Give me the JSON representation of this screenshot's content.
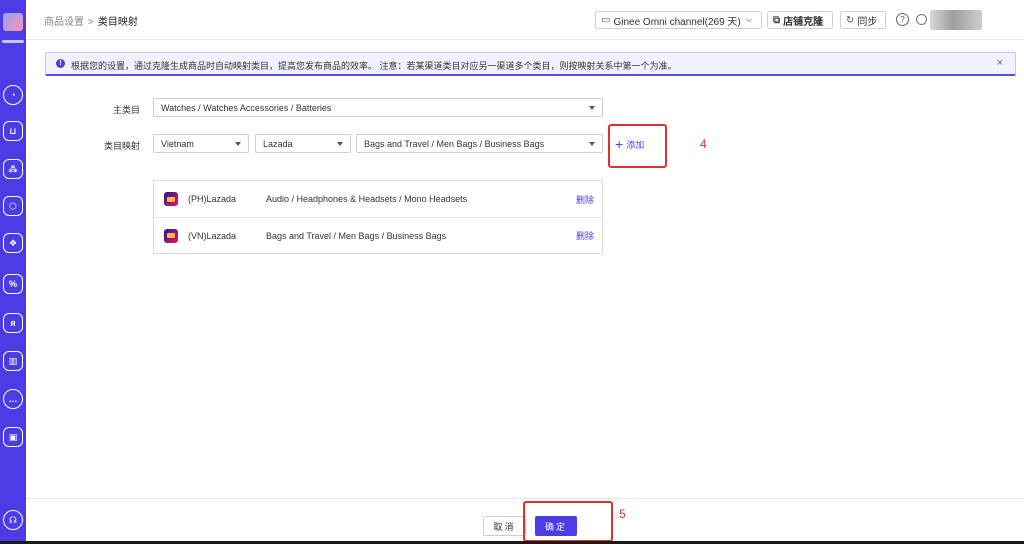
{
  "colors": {
    "accent": "#4b3ce6",
    "annotation": "#e03131"
  },
  "sidebar": {
    "items": [
      {
        "name": "dashboard-icon",
        "glyph": "◔"
      },
      {
        "name": "cart-icon",
        "glyph": "⊔"
      },
      {
        "name": "sitemap-icon",
        "glyph": "⁂"
      },
      {
        "name": "box-icon",
        "glyph": "⬡"
      },
      {
        "name": "dropbox-icon",
        "glyph": "❖"
      },
      {
        "name": "percent-icon",
        "glyph": "%"
      },
      {
        "name": "users-icon",
        "glyph": "ᴙ"
      },
      {
        "name": "chart-icon",
        "glyph": "▥"
      },
      {
        "name": "chat-icon",
        "glyph": "…"
      },
      {
        "name": "plugin-icon",
        "glyph": "▣"
      },
      {
        "name": "headset-icon",
        "glyph": "☊"
      }
    ]
  },
  "header": {
    "breadcrumb": {
      "parent": "商品设置",
      "separator": ">",
      "current": "类目映射"
    },
    "channel": "Ginee Omni channel(269 天)",
    "shop_clone": "店铺克隆",
    "sync": "同步",
    "help": "?"
  },
  "notice": {
    "text": "根据您的设置，通过克隆生成商品时自动映射类目，提高您发布商品的效率。 注意：若某渠道类目对应另一渠道多个类目，则按映射关系中第一个为准。",
    "close": "×"
  },
  "form": {
    "main_category_label": "主类目",
    "main_category_value": "Watches / Watches Accessories / Batteries",
    "mapping_label": "类目映射",
    "country": "Vietnam",
    "platform": "Lazada",
    "target_category": "Bags and Travel / Men Bags / Business Bags",
    "add_label": "添加"
  },
  "mappings": [
    {
      "store": "(PH)Lazada",
      "category": "Audio / Headphones & Headsets / Mono Headsets",
      "action": "删除"
    },
    {
      "store": "(VN)Lazada",
      "category": "Bags and Travel / Men Bags / Business Bags",
      "action": "删除"
    }
  ],
  "annotations": {
    "add": "4",
    "confirm": "5"
  },
  "footer": {
    "cancel": "取消",
    "confirm": "确定"
  }
}
